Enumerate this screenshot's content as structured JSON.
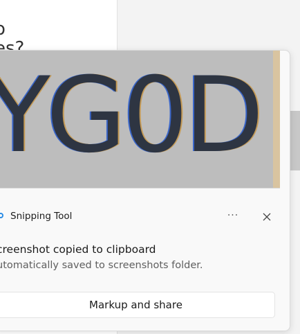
{
  "background": {
    "page_text_line1": "o",
    "page_text_line2": "es?"
  },
  "toast": {
    "preview_text": "YG0D",
    "app_name": "Snipping Tool",
    "more_label": "···",
    "close_label": "✕",
    "title": "creenshot copied to clipboard",
    "body": "utomatically saved to screenshots folder.",
    "action_label": "Markup and share"
  },
  "icons": {
    "app": "snipping-tool-icon",
    "more": "more-options-icon",
    "close": "close-icon"
  },
  "colors": {
    "toast_background": "#f9f9f9",
    "preview_background": "#bdbdbd",
    "app_icon_accent": "#2b8de6"
  }
}
